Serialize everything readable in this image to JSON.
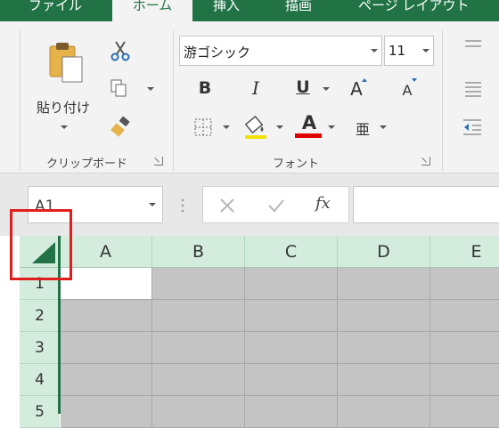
{
  "tabs": [
    {
      "label": "ファイル",
      "active": false
    },
    {
      "label": "ホーム",
      "active": true
    },
    {
      "label": "挿入",
      "active": false
    },
    {
      "label": "描画",
      "active": false
    },
    {
      "label": "ページ レイアウト",
      "active": false
    }
  ],
  "clipboard": {
    "paste_label": "貼り付け",
    "group_label": "クリップボード"
  },
  "font": {
    "font_name": "游ゴシック",
    "font_size": "11",
    "bold": "B",
    "italic": "I",
    "underline": "U",
    "grow": "A",
    "shrink": "A",
    "font_color": "A",
    "phonetic": "亜",
    "group_label": "フォント"
  },
  "formula_bar": {
    "name_box": "A1",
    "fx": "fx"
  },
  "grid": {
    "columns": [
      "A",
      "B",
      "C",
      "D",
      "E"
    ],
    "rows": [
      "1",
      "2",
      "3",
      "4",
      "5"
    ],
    "selected_cell": "A1"
  },
  "colors": {
    "accent": "#217346",
    "highlight": "#d3ecde",
    "annotation": "#e01e1e",
    "font_color_bar": "#e00000"
  }
}
